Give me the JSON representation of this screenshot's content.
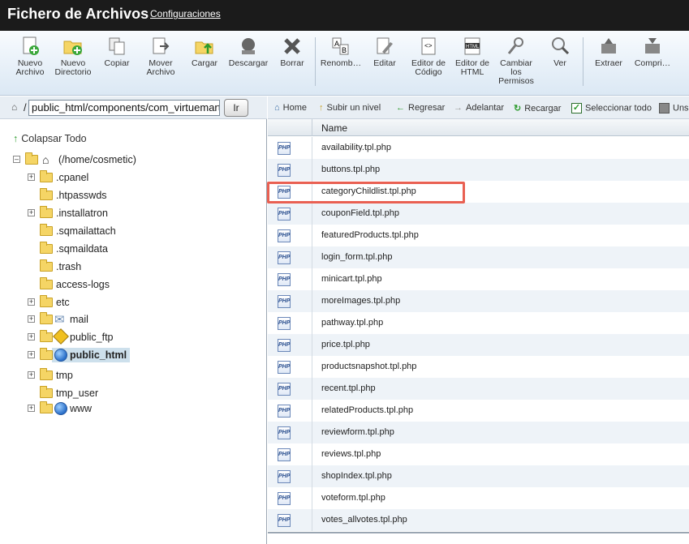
{
  "header": {
    "title": "Fichero de Archivos",
    "config_link": "Configuraciones"
  },
  "toolbar": {
    "buttons": [
      {
        "label": "Nuevo Archivo",
        "icon": "new-file-icon"
      },
      {
        "label": "Nuevo Directorio",
        "icon": "new-folder-icon"
      },
      {
        "label": "Copiar",
        "icon": "copy-icon"
      },
      {
        "label": "Mover Archivo",
        "icon": "move-file-icon"
      },
      {
        "label": "Cargar",
        "icon": "upload-icon"
      },
      {
        "label": "Descargar",
        "icon": "download-icon"
      },
      {
        "label": "Borrar",
        "icon": "delete-icon"
      },
      {
        "label": "Renomb…",
        "icon": "rename-icon"
      },
      {
        "label": "Editar",
        "icon": "edit-icon"
      },
      {
        "label": "Editor de Código",
        "icon": "code-editor-icon"
      },
      {
        "label": "Editor de HTML",
        "icon": "html-editor-icon"
      },
      {
        "label": "Cambiar los Permisos",
        "icon": "permissions-icon"
      },
      {
        "label": "Ver",
        "icon": "view-icon"
      },
      {
        "label": "Extraer",
        "icon": "extract-icon"
      },
      {
        "label": "Compri…",
        "icon": "compress-icon"
      }
    ]
  },
  "pathbar": {
    "path_value": "public_html/components/com_virtuemart",
    "go_label": "Ir"
  },
  "tree": {
    "collapse_label": "Colapsar Todo",
    "root_label": "(/home/cosmetic)",
    "items": [
      {
        "label": ".cpanel",
        "expandable": true
      },
      {
        "label": ".htpasswds",
        "expandable": false
      },
      {
        "label": ".installatron",
        "expandable": true
      },
      {
        "label": ".sqmailattach",
        "expandable": false
      },
      {
        "label": ".sqmaildata",
        "expandable": false
      },
      {
        "label": ".trash",
        "expandable": false
      },
      {
        "label": "access-logs",
        "expandable": false
      },
      {
        "label": "etc",
        "expandable": true
      },
      {
        "label": "mail",
        "expandable": true
      },
      {
        "label": "public_ftp",
        "expandable": true
      },
      {
        "label": "public_html",
        "expandable": true,
        "selected": true
      },
      {
        "label": "tmp",
        "expandable": true
      },
      {
        "label": "tmp_user",
        "expandable": false
      },
      {
        "label": "www",
        "expandable": true
      }
    ]
  },
  "nav": {
    "home": "Home",
    "up": "Subir un nivel",
    "back": "Regresar",
    "forward": "Adelantar",
    "reload": "Recargar",
    "select_all": "Seleccionar todo",
    "unselect": "Uns"
  },
  "table": {
    "name_header": "Name",
    "files": [
      "availability.tpl.php",
      "buttons.tpl.php",
      "categoryChildlist.tpl.php",
      "couponField.tpl.php",
      "featuredProducts.tpl.php",
      "login_form.tpl.php",
      "minicart.tpl.php",
      "moreImages.tpl.php",
      "pathway.tpl.php",
      "price.tpl.php",
      "productsnapshot.tpl.php",
      "recent.tpl.php",
      "relatedProducts.tpl.php",
      "reviewform.tpl.php",
      "reviews.tpl.php",
      "shopIndex.tpl.php",
      "voteform.tpl.php",
      "votes_allvotes.tpl.php"
    ],
    "file_icon_text": "PHP"
  },
  "colors": {
    "header_bg": "#1b1b1b",
    "highlight_border": "#e96052",
    "selected_bg": "#cde0ec"
  }
}
